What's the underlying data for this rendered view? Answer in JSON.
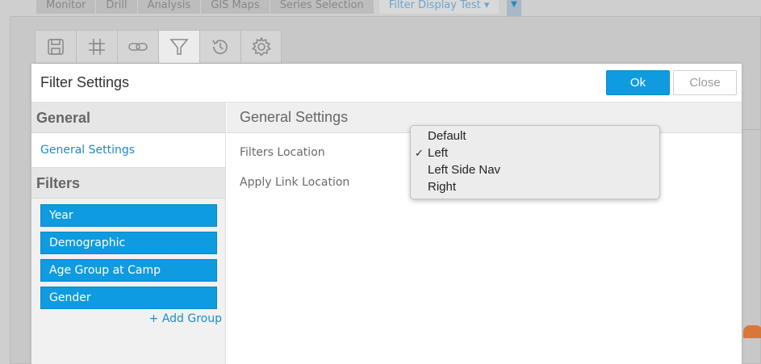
{
  "background_app": {
    "tabs": [
      {
        "label": "Monitor"
      },
      {
        "label": "Drill"
      },
      {
        "label": "Analysis"
      },
      {
        "label": "GIS Maps"
      },
      {
        "label": "Series Selection"
      }
    ],
    "active_tab": "Filter Display Test ▾"
  },
  "toolbar": {
    "icons": [
      "save-icon",
      "grid-icon",
      "link-icon",
      "filter-icon",
      "history-icon",
      "gear-icon"
    ],
    "active": "filter-icon"
  },
  "dialog": {
    "title": "Filter Settings",
    "ok_label": "Ok",
    "close_label": "Close"
  },
  "sidebar": {
    "general_heading": "General",
    "general_link": "General Settings",
    "filters_heading": "Filters",
    "filter_groups": [
      {
        "label": "Year"
      },
      {
        "label": "Demographic"
      },
      {
        "label": "Age Group at Camp"
      },
      {
        "label": "Gender"
      }
    ],
    "add_group_label": "+ Add Group"
  },
  "main": {
    "heading": "General Settings",
    "fields": [
      {
        "label": "Filters Location"
      },
      {
        "label": "Apply Link Location"
      }
    ]
  },
  "dropdown": {
    "options": [
      {
        "label": "Default",
        "checked": ""
      },
      {
        "label": "Left",
        "checked": "✓"
      },
      {
        "label": "Left Side Nav",
        "checked": ""
      },
      {
        "label": "Right",
        "checked": ""
      }
    ]
  },
  "colors": {
    "accent": "#0f9be0",
    "link": "#1d8bc9"
  }
}
